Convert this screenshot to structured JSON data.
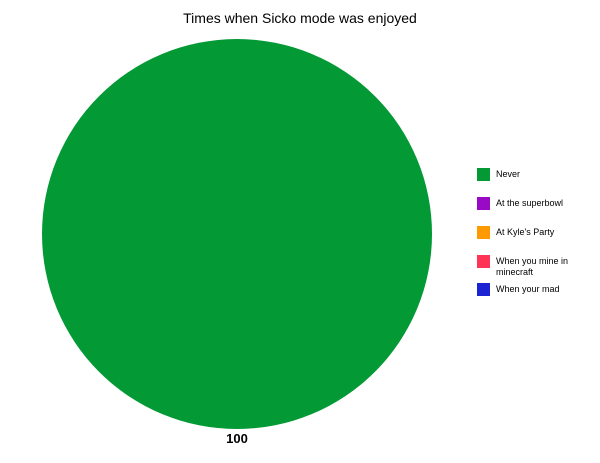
{
  "chart_data": {
    "type": "pie",
    "title": "Times when Sicko mode was enjoyed",
    "slices": [
      {
        "label": "Never",
        "value": 100,
        "color": "#039935",
        "value_label": "100"
      },
      {
        "label": "At the superbowl",
        "value": 0,
        "color": "#990AC7"
      },
      {
        "label": "At Kyle's Party",
        "value": 0,
        "color": "#FF9900"
      },
      {
        "label": "When you mine in minecraft",
        "value": 0,
        "color": "#FE3355"
      },
      {
        "label": "When your mad",
        "value": 0,
        "color": "#1C23D2"
      }
    ],
    "legend_position": "right"
  }
}
